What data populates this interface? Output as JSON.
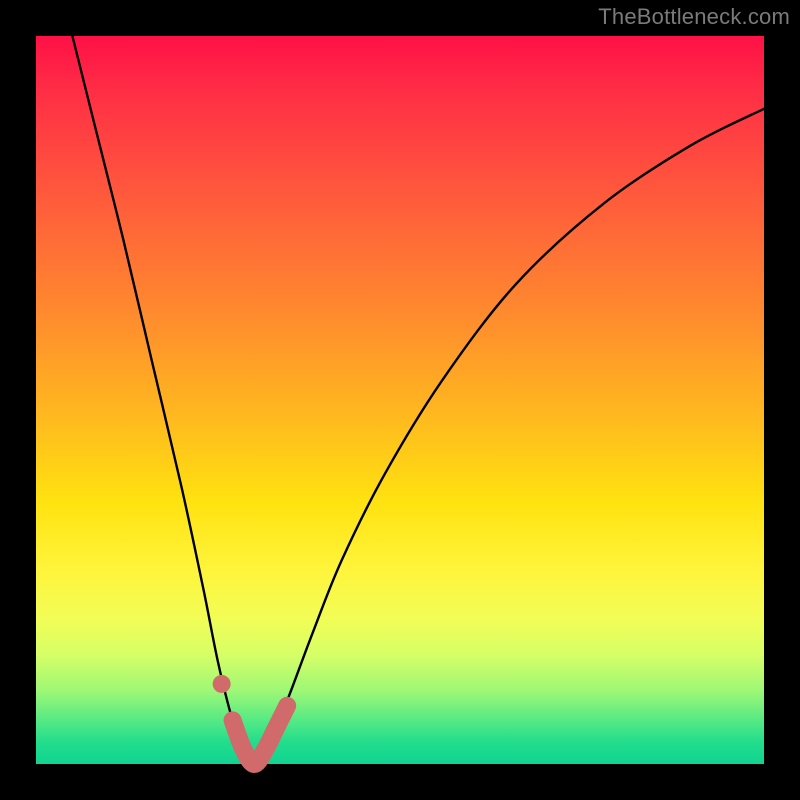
{
  "watermark": "TheBottleneck.com",
  "colors": {
    "accent": "#d16a6a",
    "curve": "#000000",
    "frame": "#000000"
  },
  "chart_data": {
    "type": "line",
    "title": "",
    "xlabel": "",
    "ylabel": "",
    "xlim": [
      0,
      100
    ],
    "ylim": [
      0,
      100
    ],
    "grid": false,
    "legend": false,
    "series": [
      {
        "name": "bottleneck-curve",
        "x": [
          5,
          8,
          12,
          16,
          20,
          23,
          25,
          27,
          28.5,
          30,
          31.5,
          33,
          35,
          38,
          42,
          48,
          56,
          66,
          78,
          90,
          100
        ],
        "y": [
          100,
          88,
          72,
          55,
          38,
          24,
          14,
          6,
          2,
          0,
          2,
          5,
          10,
          18,
          28,
          40,
          53,
          66,
          77,
          85,
          90
        ]
      }
    ],
    "accent_segment": {
      "name": "optimal-range-marker",
      "x": [
        27,
        28.5,
        30,
        31.5,
        33,
        34.5
      ],
      "y": [
        6,
        2,
        0,
        2,
        5,
        8
      ]
    },
    "accent_dot": {
      "x": 25.5,
      "y": 11
    },
    "background_gradient": {
      "type": "vertical",
      "stops": [
        {
          "pos": 0,
          "color": "#ff1147"
        },
        {
          "pos": 50,
          "color": "#ffd21a"
        },
        {
          "pos": 100,
          "color": "#10d492"
        }
      ]
    }
  }
}
